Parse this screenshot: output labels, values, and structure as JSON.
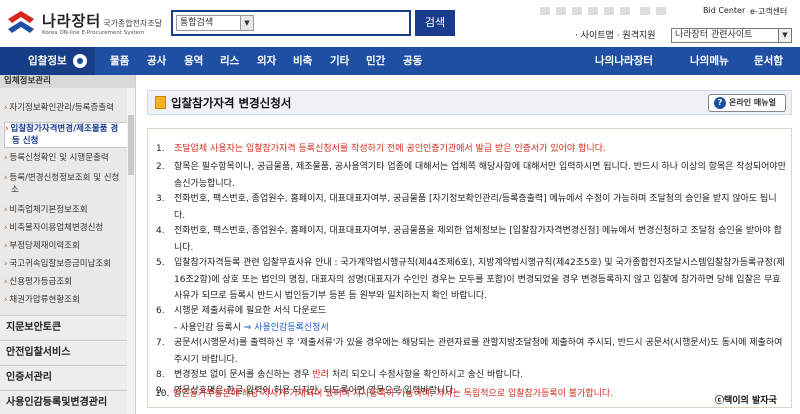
{
  "header": {
    "logo_name": "나라장터",
    "logo_sub": "국가종합전자조달",
    "logo_en": "Korea ON-line E-Procurement System",
    "search_category": "통합검색",
    "search_button": "검색",
    "top_link_1": "Bid Center",
    "top_link_2": "e-고객센터",
    "sitemap": "· 사이트맵 · 원격지원",
    "site_select": "나라장터 관련사이트"
  },
  "gnb": {
    "first": "입찰정보",
    "items": [
      "물품",
      "공사",
      "용역",
      "리스",
      "외자",
      "비축",
      "기타",
      "민간",
      "공동"
    ],
    "right_items": [
      "나의나라장터",
      "나의메뉴",
      "문서함"
    ]
  },
  "lnb": {
    "head": "입체정보관리",
    "subs": [
      "자기정보확인관리/등록증출력",
      "입찰참가자격변경/제조물품 경",
      "등 신청",
      "등록신청확인 및 시행문출력",
      "등록/변경신청정보조회 및 신청",
      "소",
      "비축업체기본정보조회",
      "비축물자이용업체변경신청",
      "부정당제재이력조회",
      "국고귀속입찰보증금미납조회",
      "신용평가등급조회",
      "채권가압류현황조회"
    ],
    "mains": [
      "지문보안토큰",
      "안전입찰서비스",
      "인증서관리",
      "사용인감등록및변경관리"
    ]
  },
  "page": {
    "title": "입찰참가자격 변경신청서",
    "manual": "온라인 매뉴얼",
    "note": "ⓒ택이의 발자국"
  },
  "items": [
    {
      "num": "1.",
      "text": "조달업체 사용자는 입찰참가자격 등록신청서를 작성하기 전에 공인인증기관에서 발급 받은 인증서가 있어야 합니다."
    },
    {
      "num": "2.",
      "text": "항목은 필수항목이나, 공급물품, 제조물품, 공사용역기타 업종에 대해서는 업체쪽 해당사항에 대해서만 입력하시면 됩니다. 반드시 하나 이상의 항목은 작성되어야만 송신가능합니다."
    },
    {
      "num": "3.",
      "text": "전화번호, 팩스번호, 종업원수, 홈페이지, 대표대표자여부, 공급물품 [자기정보확인관리/등록증출력] 메뉴에서 수정이 가능하며 조달청의 승인을 받지 않아도 됩니다."
    },
    {
      "num": "4.",
      "text": "전화번호, 팩스번호, 종업원수, 홈페이지, 대표대표자여부, 공급물품을 제외한 업체정보는 [입찰참가자격변경신청] 메뉴에서 변경신청하고 조달청 승인을 받아야 합니다."
    },
    {
      "num": "5.",
      "text": "입찰참가자격등록 관련 입찰무효사유 안내 : 국가계약법시행규칙(제44조제6호), 지방계약법시행규칙(제42조5호) 및 국가종합전자조달시스템입찰참가등록규정(제16조2항)에 상호 또는 법인의 명칭, 대표자의 성명(대표자가 수인인 경우는 모두를 포함)이 변경되었을 경우 변경등록하지 않고 입찰에 참가하면 당해 입찰은 무효 사유가 되므로 등록시 반드시 법인등기부 등본 등 원부와 일치하는지 확인 바랍니다."
    },
    {
      "num": "6.",
      "text_a": "시행문 제출서류에 필요한 서식 다운로드",
      "text_b": "- 사용인감 등록시 ",
      "text_link": "⇒ 사용인감등록신청서"
    },
    {
      "num": "7.",
      "text": "공문서(시행문서)를 출력하신 후 '제출서류'가 있을 경우에는 해당되는 관련자료를 관할지방조달청에 제출하여 주시되, 반드시 공문서(시행문서)도 동시에 제출하여 주시기 바랍니다."
    },
    {
      "num": "8.",
      "text_a": "변경정보 없이 문서를 송신하는 경우 ",
      "text_red": "반려",
      "text_b": " 처리 되오니 수정사항을 확인하시고 송신 바랍니다."
    },
    {
      "num": "9.",
      "text": "영문상호명은 한글 입력이 허용 되지만, 되도록이면 영문으로 입력바랍니다."
    },
    {
      "num": "10.",
      "text": "법인등기부등본에 해당 지사가 기재되어 있어야 지사등록이 가능하며, 지사는 독립적으로 입찰참가등록이 불가합니다."
    }
  ]
}
